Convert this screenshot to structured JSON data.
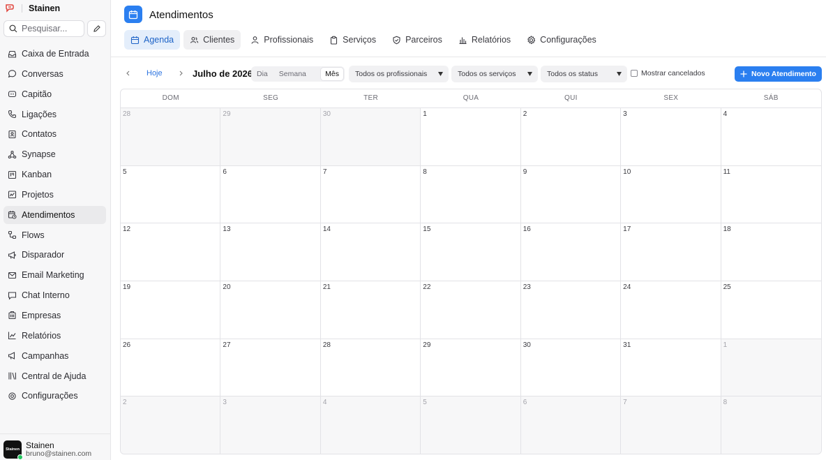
{
  "brand": {
    "name": "Stainen",
    "accent": "#e0433b"
  },
  "search": {
    "placeholder": "Pesquisar..."
  },
  "sidebar": {
    "items": [
      {
        "label": "Caixa de Entrada",
        "icon": "inbox-icon"
      },
      {
        "label": "Conversas",
        "icon": "chat-bubble-icon"
      },
      {
        "label": "Capitão",
        "icon": "bot-icon"
      },
      {
        "label": "Ligações",
        "icon": "phone-icon"
      },
      {
        "label": "Contatos",
        "icon": "contacts-icon"
      },
      {
        "label": "Synapse",
        "icon": "network-icon"
      },
      {
        "label": "Kanban",
        "icon": "kanban-icon"
      },
      {
        "label": "Projetos",
        "icon": "projects-icon"
      },
      {
        "label": "Atendimentos",
        "icon": "calendar-clock-icon",
        "active": true
      },
      {
        "label": "Flows",
        "icon": "flow-icon"
      },
      {
        "label": "Disparador",
        "icon": "megaphone-icon"
      },
      {
        "label": "Email Marketing",
        "icon": "mail-icon"
      },
      {
        "label": "Chat Interno",
        "icon": "chat-square-icon"
      },
      {
        "label": "Empresas",
        "icon": "building-icon"
      },
      {
        "label": "Relatórios",
        "icon": "chart-line-icon"
      },
      {
        "label": "Campanhas",
        "icon": "campaign-icon"
      },
      {
        "label": "Central de Ajuda",
        "icon": "library-icon"
      },
      {
        "label": "Configurações",
        "icon": "settings-icon"
      }
    ]
  },
  "user": {
    "name": "Stainen",
    "email": "bruno@stainen.com",
    "avatar_text": "Stainen",
    "status_color": "#22c55e"
  },
  "header": {
    "title": "Atendimentos",
    "tabs": [
      {
        "label": "Agenda",
        "icon": "calendar-icon",
        "active": true
      },
      {
        "label": "Clientes",
        "icon": "users-icon"
      },
      {
        "label": "Profissionais",
        "icon": "user-tie-icon"
      },
      {
        "label": "Serviços",
        "icon": "clipboard-icon"
      },
      {
        "label": "Parceiros",
        "icon": "shield-icon"
      },
      {
        "label": "Relatórios",
        "icon": "bar-chart-icon"
      },
      {
        "label": "Configurações",
        "icon": "gear-icon"
      }
    ]
  },
  "toolbar": {
    "prev": "‹",
    "today": "Hoje",
    "next": "›",
    "month_label": "Julho de 2026",
    "views": [
      "Dia",
      "Semana",
      "Mês"
    ],
    "active_view": "Mês",
    "filter_professionals": "Todos os profissionais",
    "filter_services": "Todos os serviços",
    "filter_status": "Todos os status",
    "show_cancelled": "Mostrar cancelados",
    "new_button": "Novo Atendimento"
  },
  "calendar": {
    "weekdays": [
      "DOM",
      "SEG",
      "TER",
      "QUA",
      "QUI",
      "SEX",
      "SÁB"
    ],
    "days": [
      {
        "d": "28",
        "out": true
      },
      {
        "d": "29",
        "out": true
      },
      {
        "d": "30",
        "out": true
      },
      {
        "d": "1"
      },
      {
        "d": "2"
      },
      {
        "d": "3"
      },
      {
        "d": "4"
      },
      {
        "d": "5"
      },
      {
        "d": "6"
      },
      {
        "d": "7"
      },
      {
        "d": "8"
      },
      {
        "d": "9"
      },
      {
        "d": "10"
      },
      {
        "d": "11"
      },
      {
        "d": "12"
      },
      {
        "d": "13"
      },
      {
        "d": "14"
      },
      {
        "d": "15"
      },
      {
        "d": "16"
      },
      {
        "d": "17"
      },
      {
        "d": "18"
      },
      {
        "d": "19"
      },
      {
        "d": "20"
      },
      {
        "d": "21"
      },
      {
        "d": "22"
      },
      {
        "d": "23"
      },
      {
        "d": "24"
      },
      {
        "d": "25"
      },
      {
        "d": "26"
      },
      {
        "d": "27"
      },
      {
        "d": "28"
      },
      {
        "d": "29"
      },
      {
        "d": "30"
      },
      {
        "d": "31"
      },
      {
        "d": "1",
        "out": true
      },
      {
        "d": "2",
        "out": true
      },
      {
        "d": "3",
        "out": true
      },
      {
        "d": "4",
        "out": true
      },
      {
        "d": "5",
        "out": true
      },
      {
        "d": "6",
        "out": true
      },
      {
        "d": "7",
        "out": true
      },
      {
        "d": "8",
        "out": true
      }
    ]
  },
  "colors": {
    "primary": "#2b7ff0",
    "active_tab_bg": "#e4eefb"
  }
}
